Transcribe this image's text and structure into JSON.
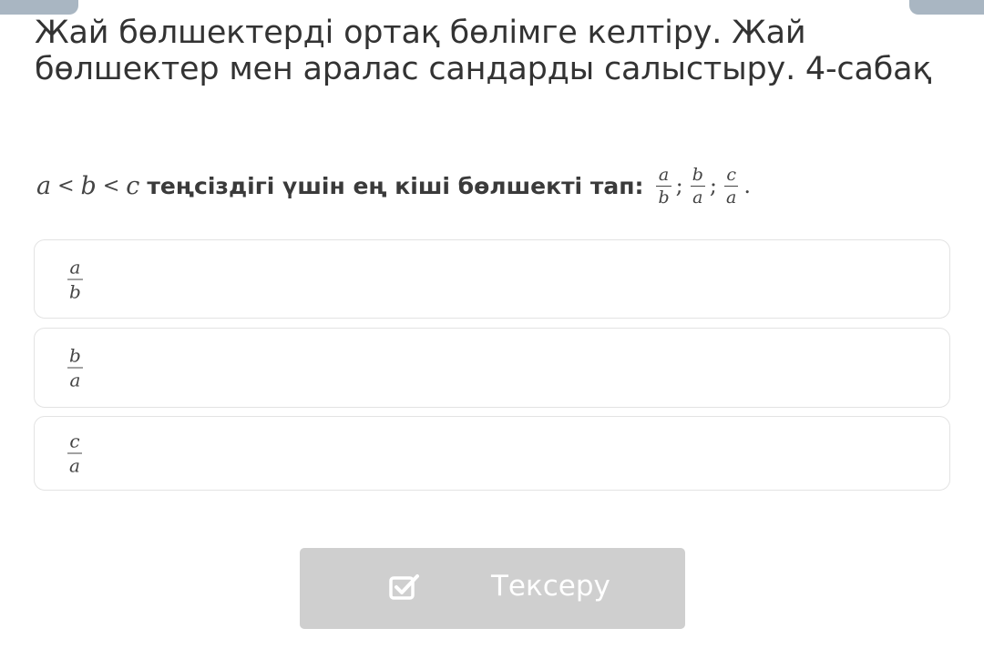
{
  "lesson": {
    "title": "Жай бөлшектерді ортақ бөлімге келтіру. Жай бөлшектер мен аралас сандарды салыстыру. 4-сабақ"
  },
  "question": {
    "condition": {
      "a": "a",
      "lt1": "<",
      "b": "b",
      "lt2": "<",
      "c": "c"
    },
    "text": "теңсіздігі үшін ең кіші бөлшекті тап:",
    "fractions": [
      {
        "num": "a",
        "den": "b"
      },
      {
        "num": "b",
        "den": "a"
      },
      {
        "num": "c",
        "den": "a"
      }
    ],
    "separator": ";",
    "end": "."
  },
  "options": [
    {
      "num": "a",
      "den": "b"
    },
    {
      "num": "b",
      "den": "a"
    },
    {
      "num": "c",
      "den": "a"
    }
  ],
  "check_button": {
    "label": "Тексеру",
    "icon": "checkbox-check-icon"
  },
  "colors": {
    "corner_tab": "#a9b6c2",
    "button_bg": "#cfcfcf",
    "option_border": "#e3e3e3",
    "text": "#333333"
  }
}
